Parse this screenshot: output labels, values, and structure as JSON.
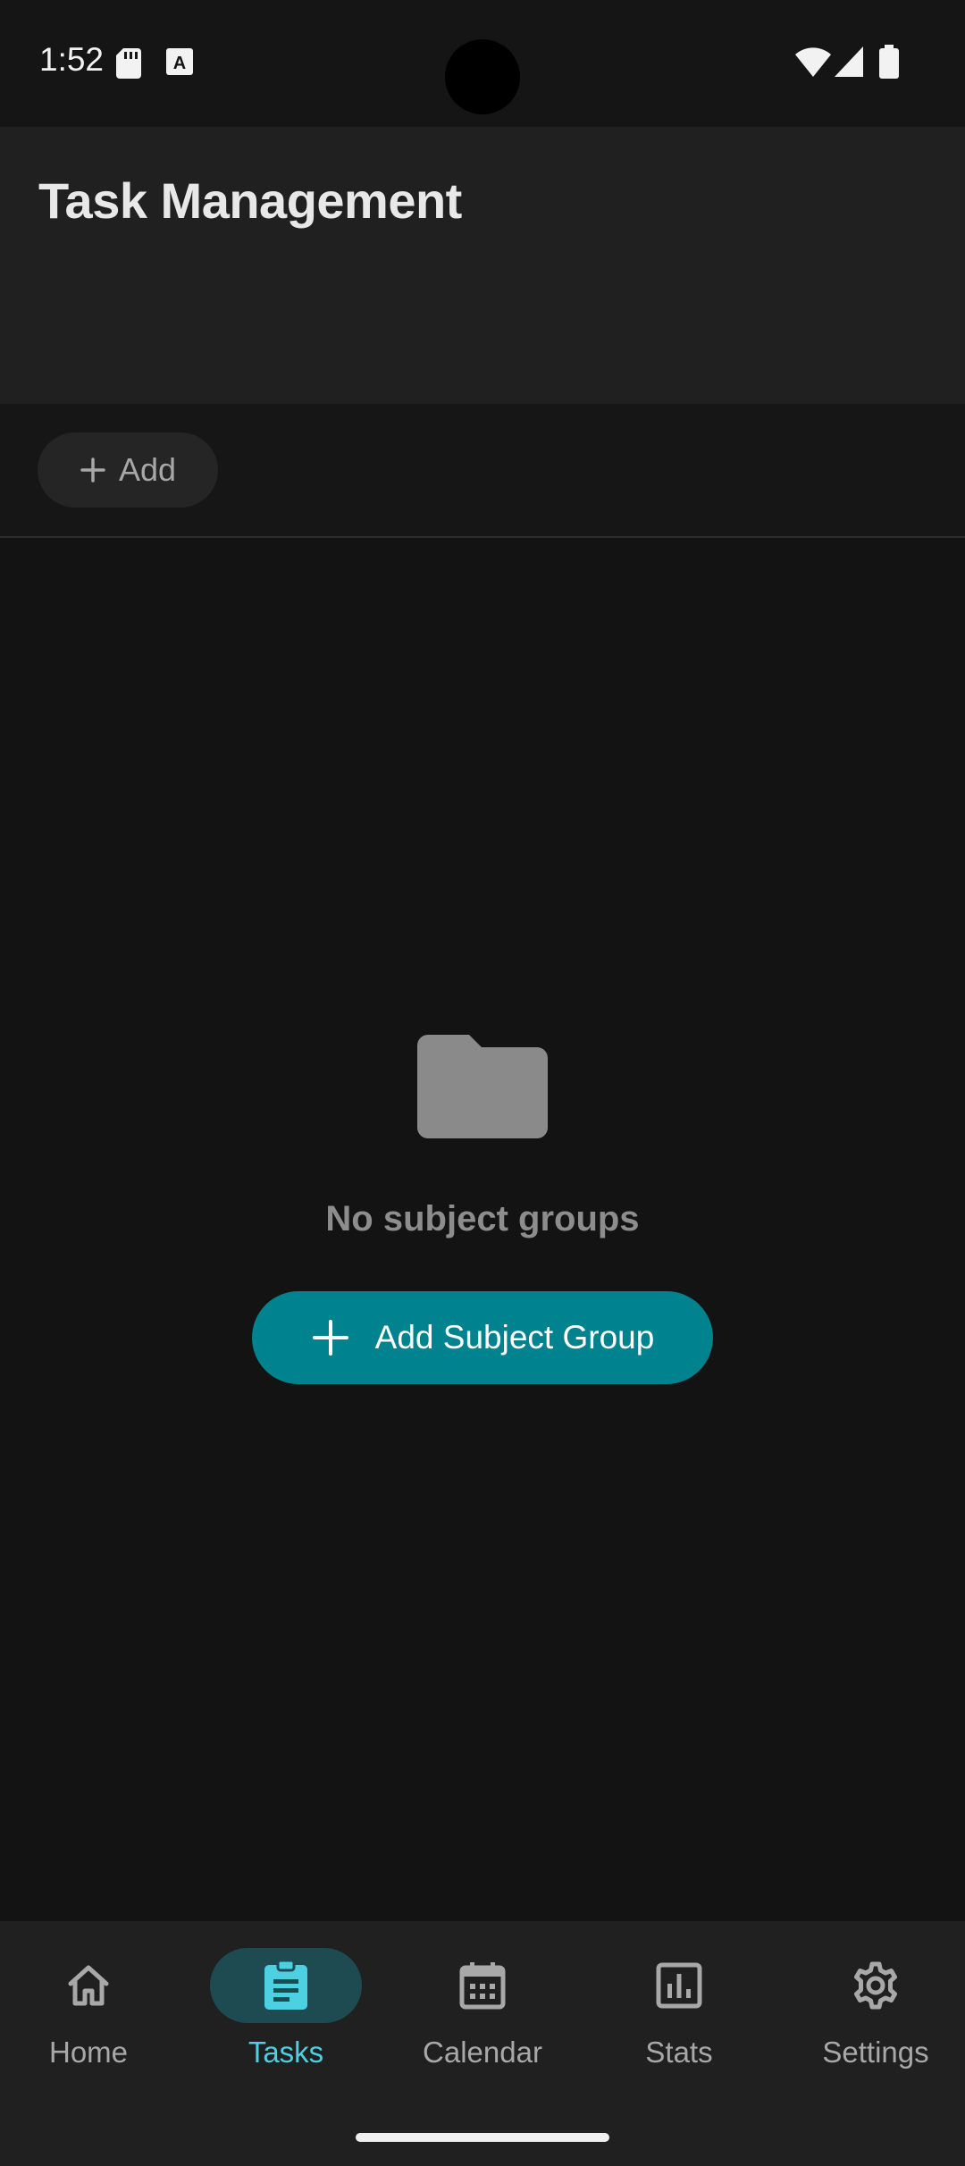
{
  "status_bar": {
    "time": "1:52",
    "icons": [
      "sd-card-icon",
      "keyboard-a-icon",
      "wifi-icon",
      "signal-icon",
      "battery-icon"
    ]
  },
  "header": {
    "title": "Task Management"
  },
  "toolbar": {
    "add_label": "Add",
    "add_icon": "plus-icon"
  },
  "empty_state": {
    "icon": "folder-icon",
    "message": "No subject groups",
    "button_label": "Add Subject Group",
    "button_icon": "plus-icon"
  },
  "bottom_nav": {
    "items": [
      {
        "label": "Home",
        "icon": "home-icon"
      },
      {
        "label": "Tasks",
        "icon": "clipboard-icon",
        "active": true
      },
      {
        "label": "Calendar",
        "icon": "calendar-icon"
      },
      {
        "label": "Stats",
        "icon": "bar-chart-icon"
      },
      {
        "label": "Settings",
        "icon": "gear-icon"
      }
    ]
  },
  "colors": {
    "background": "#131313",
    "surface": "#202020",
    "accent": "#00838f",
    "active_nav_text": "#4dd0e1",
    "active_nav_pill": "#1e4a52"
  }
}
